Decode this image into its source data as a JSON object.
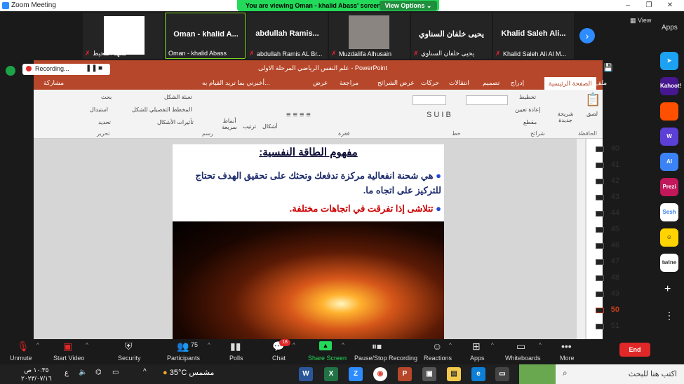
{
  "window": {
    "title": "Zoom Meeting",
    "minimize": "–",
    "restore": "❐",
    "close": "✕"
  },
  "banner": {
    "text": "You are viewing Oman - khalid Abass' screen",
    "view_options": "View Options ⌄"
  },
  "thumbnails": [
    {
      "name": "معهد المحيط",
      "big": ""
    },
    {
      "name": "Oman - khalid Abass",
      "big": "Oman - khalid A..."
    },
    {
      "name": "abdullah Ramis AL Br...",
      "big": "abdullah  Ramis..."
    },
    {
      "name": "Muzdalifa Alhusain",
      "big": ""
    },
    {
      "name": "يحيى خلفان السناوي",
      "big": "يحيى خلفان السناوي"
    },
    {
      "name": "Khalid Saleh Ali Al M...",
      "big": "Khalid Saleh Ali..."
    }
  ],
  "view_label": "View",
  "apps_label": "Apps",
  "apps": [
    "Kahoot!",
    "AI",
    "Prezi",
    "Sesh",
    "twine",
    "W"
  ],
  "recording": {
    "label": "Recording..."
  },
  "ppt": {
    "title": "علم النفس الرياضي المرحلة الاولى - PowerPoint",
    "tabs": [
      "ملف",
      "الصفحة الرئيسية",
      "إدراج",
      "تصميم",
      "انتقالات",
      "حركات",
      "عرض الشرائح",
      "مراجعة",
      "عرض"
    ],
    "tell_me": "أخبرني بما تريد القيام به...",
    "share": "مشاركة",
    "ribbon": {
      "paste": "لصق",
      "new_slide": "شريحة جديدة",
      "layout": "تخطيط",
      "reset": "إعادة تعيين",
      "section": "مقطع",
      "shapes": "أشكال",
      "arrange": "ترتيب",
      "quick_styles": "أنماط سريعة",
      "shape_fill": "تعبئة الشكل",
      "shape_outline": "المخطط التفصيلي للشكل",
      "shape_effects": "تأثيرات الأشكال",
      "find": "بحث",
      "replace": "استبدال",
      "select": "تحديد",
      "groups": [
        "الحافظة",
        "شرائح",
        "خط",
        "فقرة",
        "رسم",
        "تحرير"
      ]
    },
    "slide": {
      "heading": "مفهوم الطاقة النفسية:",
      "bullet1": "هي شحنة انفعالية مركزة تدفعك وتحثك على تحقيق الهدف تحتاج للتركيز على اتجاه ما.",
      "bullet2": "تتلاشى إذا تفرقت في اتجاهات مختلفة."
    },
    "slide_numbers": [
      "40",
      "41",
      "42",
      "43",
      "44",
      "45",
      "46",
      "47",
      "48",
      "49",
      "50",
      "51"
    ],
    "current_slide": "50"
  },
  "toolbar": {
    "unmute": "Unmute",
    "start_video": "Start Video",
    "security": "Security",
    "participants": "Participants",
    "participants_count": "75",
    "polls": "Polls",
    "chat": "Chat",
    "chat_badge": "18",
    "share_screen": "Share Screen",
    "pause_rec": "Pause/Stop Recording",
    "reactions": "Reactions",
    "apps": "Apps",
    "whiteboards": "Whiteboards",
    "more": "More",
    "end": "End"
  },
  "taskbar": {
    "search": "اكتب هنا للبحث",
    "weather_temp": "35°C",
    "weather_text": "مشمس",
    "time": "١٠:٣٥ ص",
    "date": "٢٠٢٣/٠٧/١٦",
    "lang": "ع"
  },
  "colors": {
    "zoom_blue": "#2d8cff",
    "banner_green": "#23d959",
    "ppt_red": "#b7472a",
    "end_red": "#e02828"
  }
}
